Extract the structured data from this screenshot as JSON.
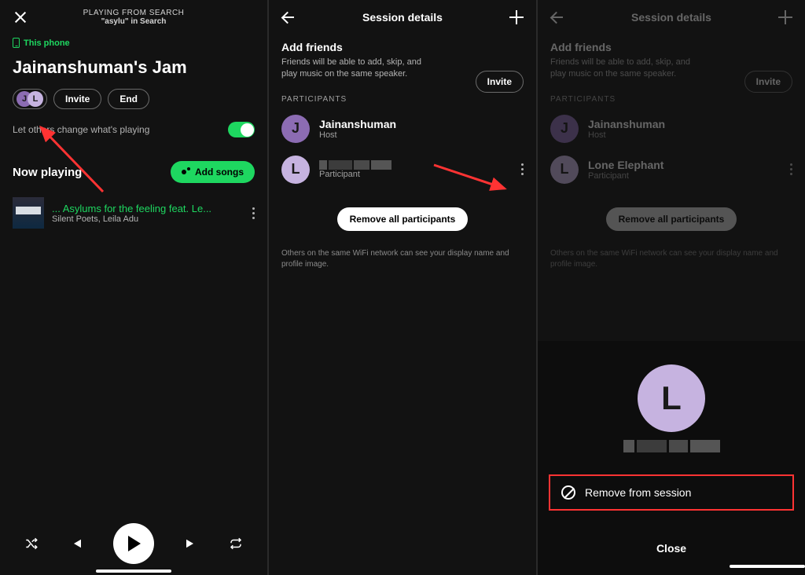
{
  "colors": {
    "accent_green": "#1ed760",
    "avatar_purple_a": "#8c6cb3",
    "avatar_purple_b": "#c6b3e0",
    "annotation_red": "#ff3333"
  },
  "screen1": {
    "header_line1": "PLAYING FROM SEARCH",
    "header_line2": "\"asylu\" in Search",
    "this_phone": "This phone",
    "jam_title": "Jainanshuman's Jam",
    "avatar_pill": {
      "initials": [
        "J",
        "L"
      ]
    },
    "invite_label": "Invite",
    "end_label": "End",
    "let_others_label": "Let others change what's playing",
    "let_others_on": true,
    "now_playing_label": "Now playing",
    "add_songs_label": "Add songs",
    "track": {
      "title": "... Asylums for the feeling feat. Le...",
      "artist": "Silent Poets, Leila Adu"
    }
  },
  "screen2": {
    "header_title": "Session details",
    "add_friends_title": "Add friends",
    "add_friends_sub": "Friends will be able to add, skip, and play music on the same speaker.",
    "invite_label": "Invite",
    "participants_caption": "PARTICIPANTS",
    "participants": [
      {
        "initial": "J",
        "name": "Jainanshuman",
        "role": "Host"
      },
      {
        "initial": "L",
        "name_redacted": true,
        "role": "Participant"
      }
    ],
    "remove_all_label": "Remove all participants",
    "disclaimer": "Others on the same WiFi network can see your display name and profile image."
  },
  "screen3": {
    "header_title": "Session details",
    "add_friends_title": "Add friends",
    "add_friends_sub": "Friends will be able to add, skip, and play music on the same speaker.",
    "invite_label": "Invite",
    "participants_caption": "PARTICIPANTS",
    "participants": [
      {
        "initial": "J",
        "name": "Jainanshuman",
        "role": "Host"
      },
      {
        "initial": "L",
        "name": "Lone Elephant",
        "role": "Participant"
      }
    ],
    "remove_all_label": "Remove all participants",
    "disclaimer": "Others on the same WiFi network can see your display name and profile image.",
    "sheet": {
      "avatar_initial": "L",
      "remove_label": "Remove from session",
      "close_label": "Close"
    }
  }
}
